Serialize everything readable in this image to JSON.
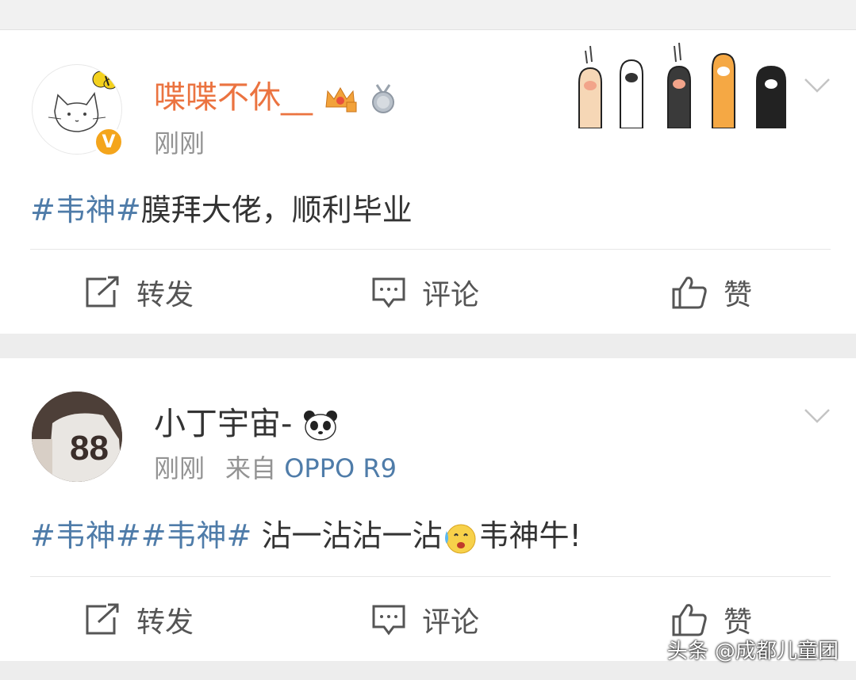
{
  "posts": [
    {
      "username": "喋喋不休__",
      "time": "刚刚",
      "source_prefix": "",
      "source": "",
      "text_parts": {
        "topic1": "#韦神#",
        "body": "膜拜大佬，顺利毕业"
      },
      "verified_badge": "V"
    },
    {
      "username": "小丁宇宙-",
      "time": "刚刚",
      "source_prefix": "来自",
      "source": "OPPO R9",
      "text_parts": {
        "topic1": "#韦神#",
        "topic2": "#韦神#",
        "body": " 沾一沾沾一沾",
        "body2": "韦神牛!"
      }
    }
  ],
  "actions": {
    "repost": "转发",
    "comment": "评论",
    "like": "赞"
  },
  "watermark": "头条 @成都儿童团",
  "icons": [
    "chevron-down-icon",
    "repost-icon",
    "comment-icon",
    "thumbs-up-icon",
    "crown-badge-icon",
    "medal-badge-icon",
    "panda-emoji-icon",
    "crying-emoji-icon"
  ],
  "colors": {
    "username_highlight": "#eb7340",
    "topic": "#4f7ca9",
    "meta": "#939393",
    "verified": "#f4a51c"
  }
}
